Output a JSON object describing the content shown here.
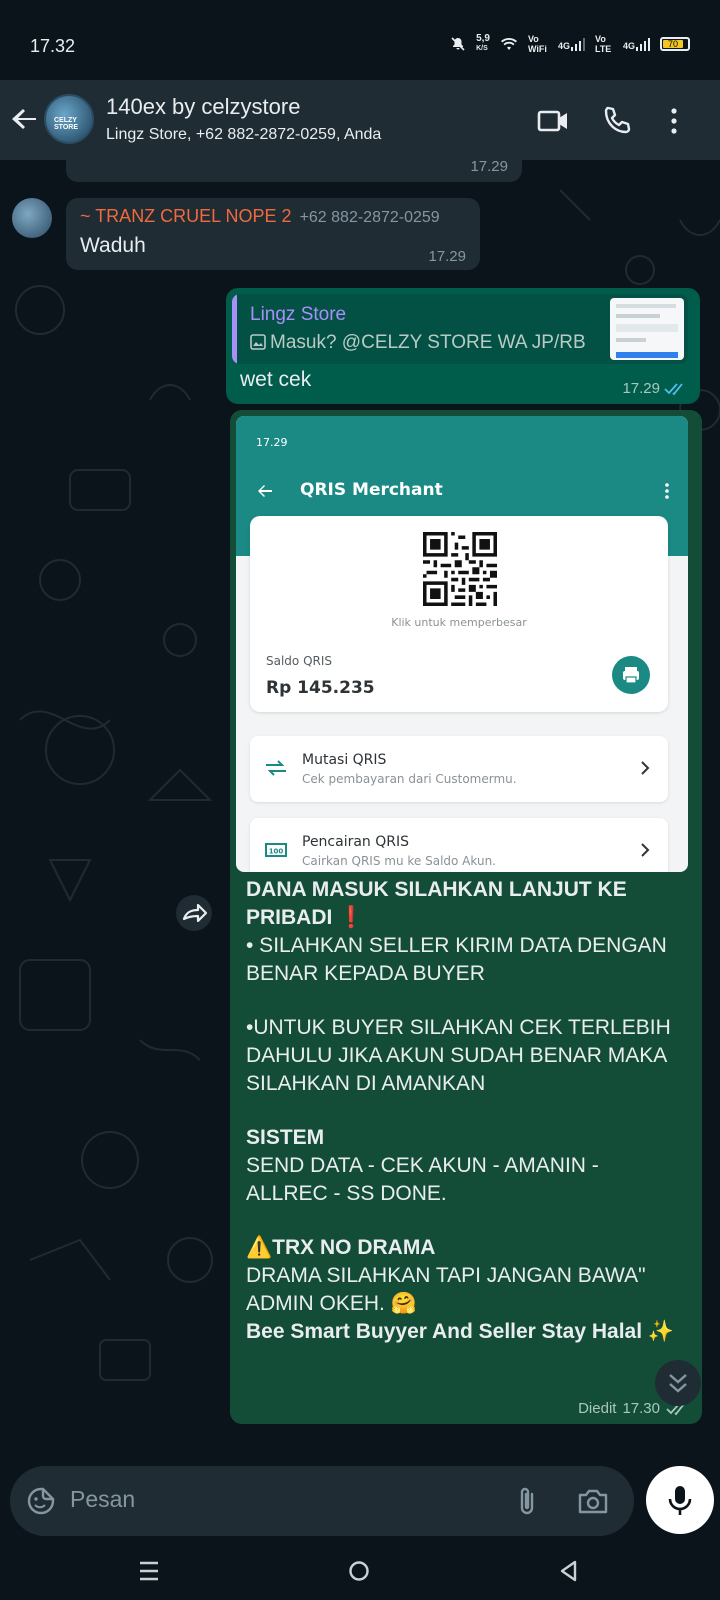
{
  "status_bar": {
    "time": "17.32",
    "net_speed": "5,9",
    "net_unit": "K/S",
    "vowifi": "Vo WiFi",
    "lte1": "4G",
    "volte": "Vo LTE",
    "lte2": "4G",
    "battery": "70"
  },
  "header": {
    "title": "140ex by celzystore",
    "subtitle": "Lingz Store, +62 882-2872-0259, Anda",
    "avatar_text": "CELZY STORE"
  },
  "messages": {
    "prev_time": "17.29",
    "m1": {
      "sender": "~ TRANZ CRUEL NOPE 2",
      "phone": "+62 882-2872-0259",
      "text": "Waduh",
      "time": "17.29"
    },
    "m2": {
      "quote_sender": "Lingz Store",
      "quote_text": "Masuk? @CELZY STORE WA JP/RB",
      "text": "wet cek",
      "time": "17.29"
    },
    "m3": {
      "shot": {
        "time": "17.29",
        "title": "QRIS Merchant",
        "qr_hint": "Klik untuk memperbesar",
        "saldo_label": "Saldo QRIS",
        "saldo_value": "Rp 145.235",
        "card1_title": "Mutasi QRIS",
        "card1_sub": "Cek pembayaran dari Customermu.",
        "card2_title": "Pencairan QRIS",
        "card2_sub": "Cairkan QRIS mu ke Saldo Akun."
      },
      "line1": "DANA MASUK SILAHKAN LANJUT KE PRIBADI ❗",
      "line2": "• SILAHKAN SELLER KIRIM DATA DENGAN BENAR KEPADA BUYER",
      "line3": "•UNTUK BUYER SILAHKAN CEK TERLEBIH DAHULU JIKA AKUN SUDAH BENAR MAKA SILAHKAN DI AMANKAN",
      "line4": "SISTEM",
      "line5": "SEND DATA - CEK AKUN - AMANIN - ALLREC - SS DONE.",
      "line6": "⚠️TRX NO DRAMA",
      "line7": "DRAMA SILAHKAN TAPI JANGAN BAWA\" ADMIN OKEH. 🤗",
      "line8": "Bee Smart Buyyer And Seller Stay Halal ✨",
      "edited": "Diedit",
      "time": "17.30"
    }
  },
  "input": {
    "placeholder": "Pesan"
  },
  "colors": {
    "accent": "#1b8a84",
    "outgoing_bubble": "#005c4b",
    "incoming_bubble": "#1f2c34",
    "read_ticks": "#53bdeb",
    "sender_name": "#f0693f"
  }
}
